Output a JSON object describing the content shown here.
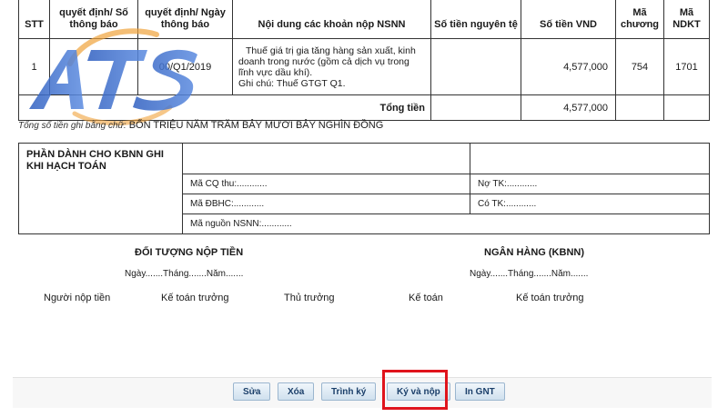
{
  "table": {
    "headers": {
      "stt": "STT",
      "so_thong_bao": "quyết định/ Số thông báo",
      "ngay_thong_bao": "quyết định/ Ngày thông báo",
      "noi_dung": "Nội dung các khoản nộp NSNN",
      "so_tien_nguyen_te": "Số tiền nguyên tệ",
      "so_tien_vnd": "Số tiền VND",
      "ma_chuong": "Mã chương",
      "ma_ndkt": "Mã NDKT"
    },
    "row": {
      "stt": "1",
      "so_thong_bao": "",
      "ngay_thong_bao": "00/Q1/2019",
      "noi_dung_1": "Thuế giá trị gia tăng hàng sản xuất, kinh",
      "noi_dung_2": "doanh trong nước (gồm cả dịch vụ trong",
      "noi_dung_3": "lĩnh vực dầu khí).",
      "ghi_chu": "Ghi chú: Thuế GTGT Q1.",
      "so_tien_nguyen_te": "",
      "so_tien_vnd": "4,577,000",
      "ma_chuong": "754",
      "ma_ndkt": "1701"
    },
    "total_label": "Tổng tiền",
    "total_vnd": "4,577,000"
  },
  "amount_in_words": {
    "label": "Tổng số tiền ghi bằng chữ:",
    "value": "BỐN TRIỆU NĂM TRĂM BẢY MƯƠI BẢY NGHÌN ĐỒNG"
  },
  "kbnn": {
    "title_1": "PHẦN DÀNH CHO KBNN GHI",
    "title_2": "KHI HẠCH TOÁN",
    "ma_cq_thu": "Mã CQ thu:............",
    "ma_dbhc": "Mã ĐBHC:............",
    "ma_nguon": "Mã nguồn NSNN:............",
    "no_tk": "Nợ TK:............",
    "co_tk": "Có TK:............"
  },
  "signatures": {
    "left_heading": "ĐỐI TƯỢNG NỘP TIỀN",
    "right_heading": "NGÂN HÀNG (KBNN)",
    "date_line": "Ngày.......Tháng.......Năm.......",
    "roles": [
      "Người nộp tiền",
      "Kế toán trưởng",
      "Thủ trưởng",
      "Kế toán",
      "Kế toán trưởng"
    ]
  },
  "buttons": {
    "edit": "Sửa",
    "delete": "Xóa",
    "submit_sign": "Trình ký",
    "sign_and_pay": "Ký và nộp",
    "print": "In GNT"
  },
  "logo": {
    "text": "ATS",
    "colors": [
      "#3a6fc8",
      "#f0a23a"
    ]
  },
  "colors": {
    "highlight": "#e0141c",
    "button_text": "#1b3f6a"
  }
}
